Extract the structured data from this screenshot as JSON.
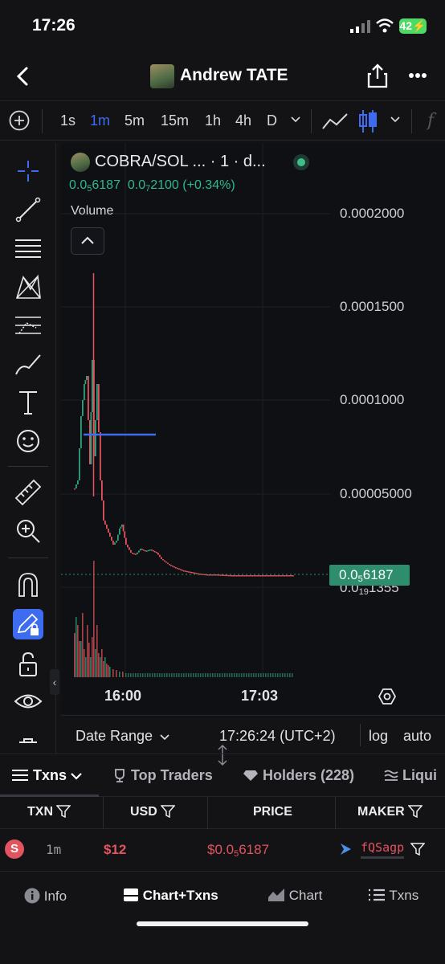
{
  "status_bar": {
    "time": "17:26",
    "battery": "42"
  },
  "header": {
    "title": "Andrew TATE"
  },
  "timeframes": {
    "items": [
      "1s",
      "1m",
      "5m",
      "15m",
      "1h",
      "4h",
      "D"
    ],
    "active": "1m"
  },
  "chart": {
    "pair_label": "COBRA/SOL ... · 1 · d...",
    "ohlc_prefix_1": "0.0",
    "ohlc_sub_1": "5",
    "ohlc_rest_1": "6187",
    "ohlc_prefix_2": "0.0",
    "ohlc_sub_2": "7",
    "ohlc_rest_2": "2100 (+0.34%)",
    "volume_label": "Volume",
    "y_ticks": [
      "0.0002000",
      "0.0001500",
      "0.0001000",
      "0.00005000"
    ],
    "hidden_tick_prefix": "0.0",
    "hidden_tick_sub": "19",
    "hidden_tick_rest": "1355",
    "price_tag_prefix": "0.0",
    "price_tag_sub": "5",
    "price_tag_rest": "6187",
    "x_ticks": [
      "16:00",
      "17:03"
    ],
    "date_range": "Date Range",
    "clock": "17:26:24 (UTC+2)",
    "log_label": "log",
    "auto_label": "auto",
    "colors": {
      "up": "#2fa37e",
      "down": "#e2545f",
      "marker_line": "#3d6cf0"
    }
  },
  "chart_data": {
    "type": "candlestick",
    "x_ticks": [
      "16:00",
      "17:03"
    ],
    "y_ticks": [
      "0.0002000",
      "0.0001500",
      "0.0001000",
      "0.00005000"
    ],
    "ylim": [
      0,
      0.00022
    ],
    "last_price": "0.0₅6187"
  },
  "tabs": {
    "txns": "Txns",
    "top_traders": "Top Traders",
    "holders": "Holders (228)",
    "liquidity": "Liqui"
  },
  "table": {
    "headers": {
      "txn": "TXN",
      "usd": "USD",
      "price": "PRICE",
      "maker": "MAKER"
    },
    "rows": [
      {
        "side": "S",
        "age": "1m",
        "usd": "$12",
        "price_prefix": "$0.0",
        "price_sub": "5",
        "price_rest": "6187",
        "maker": "fQSagp"
      }
    ]
  },
  "footer": {
    "info": "Info",
    "chart_txns": "Chart+Txns",
    "chart": "Chart",
    "txns": "Txns"
  }
}
